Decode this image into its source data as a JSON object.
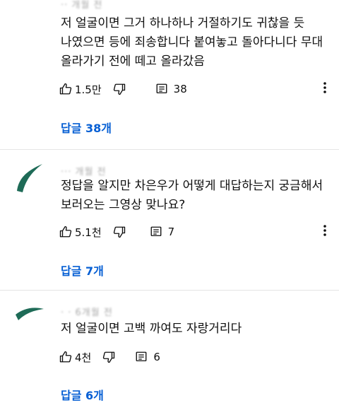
{
  "comments": [
    {
      "meta": "·· 개월 전",
      "text": "저 얼굴이면 그거 하나하나 거절하기도 귀찮을 듯\n나였으면 등에 죄송합니다 붙여놓고 돌아다니다 무대\n올라가기 전에 떼고 올라갔음",
      "likes": "1.5만",
      "replies_count": "38",
      "reply_link": "답글 38개"
    },
    {
      "meta": "···  개월 전",
      "text": "정답을 알지만 차은우가 어떻게 대답하는지 궁금해서\n보러오는 그영상 맞나요?",
      "likes": "5.1천",
      "replies_count": "7",
      "reply_link": "답글 7개"
    },
    {
      "meta": "· ·  6개월 전",
      "text": "저 얼굴이면 고백 까여도 자랑거리다",
      "likes": "4천",
      "replies_count": "6",
      "reply_link": "답글 6개"
    }
  ],
  "icons": {
    "like": "thumbs-up-icon",
    "dislike": "thumbs-down-icon",
    "reply": "comment-icon",
    "more": "more-vert-icon"
  },
  "colors": {
    "link": "#065fd4",
    "avatar": "#1e6b57",
    "divider": "#e5e5e5"
  }
}
